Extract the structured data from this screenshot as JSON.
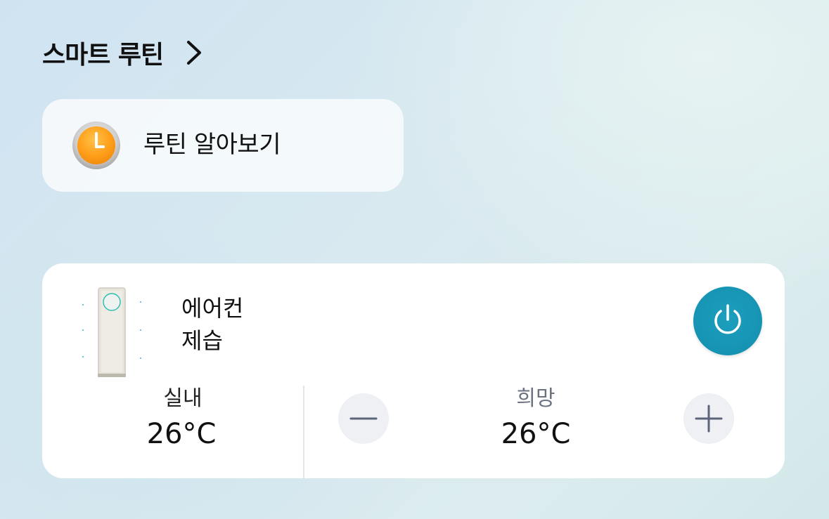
{
  "section": {
    "title": "스마트 루틴"
  },
  "routine_card": {
    "label": "루틴 알아보기",
    "icon": "clock-icon"
  },
  "device": {
    "name": "에어컨",
    "mode": "제습",
    "image": "air-conditioner-image",
    "power_icon": "power-icon",
    "accent_color": "#1693b3",
    "indoor": {
      "label": "실내",
      "value": "26°C"
    },
    "target": {
      "label": "희망",
      "value": "26°C",
      "decrease_icon": "minus-icon",
      "increase_icon": "plus-icon"
    }
  }
}
